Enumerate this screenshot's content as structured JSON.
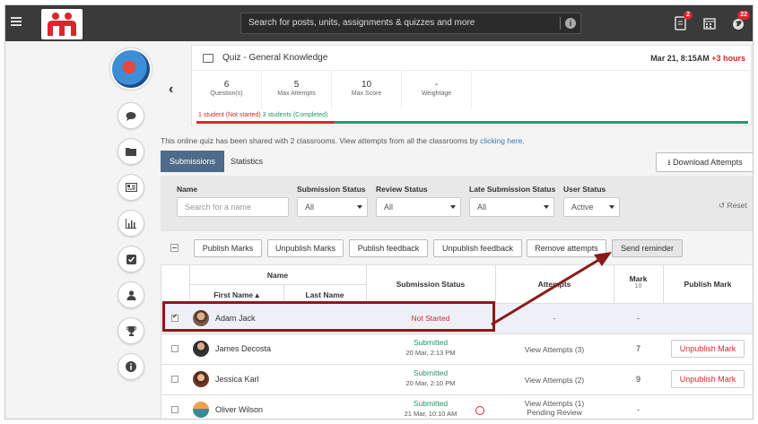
{
  "topbar": {
    "search_placeholder": "Search for posts, units, assignments & quizzes and more",
    "notifications_badge": "2",
    "globe_badge": "22"
  },
  "quiz": {
    "title": "Quiz - General Knowledge",
    "date": "Mar 21, 8:15AM",
    "late": "+3 hours",
    "stats": [
      {
        "value": "6",
        "label": "Question(s)"
      },
      {
        "value": "5",
        "label": "Max Attempts"
      },
      {
        "value": "10",
        "label": "Max Score"
      },
      {
        "value": "-",
        "label": "Weightage"
      }
    ],
    "not_started_text": "1 student (Not started)",
    "completed_text": "3 students (Completed)"
  },
  "shared": {
    "text": "This online quiz has been shared with 2 classrooms. View attempts from all the classrooms by",
    "link": "clicking here."
  },
  "tabs": {
    "submissions": "Submissions",
    "statistics": "Statistics"
  },
  "download_label": "Download Attempts",
  "filters": {
    "name_label": "Name",
    "name_placeholder": "Search for a name",
    "submission_status_label": "Submission Status",
    "submission_status_value": "All",
    "review_status_label": "Review Status",
    "review_status_value": "All",
    "late_submission_label": "Late Submission Status",
    "late_submission_value": "All",
    "user_status_label": "User Status",
    "user_status_value": "Active",
    "reset_label": "Reset"
  },
  "actions": {
    "publish_marks": "Publish Marks",
    "unpublish_marks": "Unpublish Marks",
    "publish_feedback": "Publish feedback",
    "unpublish_feedback": "Unpublish feedback",
    "remove_attempts": "Remove attempts",
    "send_reminder": "Send reminder"
  },
  "table": {
    "headers": {
      "name": "Name",
      "first_name": "First Name",
      "last_name": "Last Name",
      "submission_status": "Submission Status",
      "attempts": "Attempts",
      "mark": "Mark",
      "mark_max": "10",
      "publish_mark": "Publish Mark"
    },
    "rows": [
      {
        "name": "Adam Jack",
        "status": "Not Started",
        "date": "",
        "attempts": "-",
        "attempts2": "",
        "mark": "-",
        "publish": ""
      },
      {
        "name": "James Decosta",
        "status": "Submitted",
        "date": "20 Mar, 2:13 PM",
        "attempts": "View Attempts (3)",
        "attempts2": "",
        "mark": "7",
        "publish": "Unpublish Mark"
      },
      {
        "name": "Jessica Karl",
        "status": "Submitted",
        "date": "20 Mar, 2:10 PM",
        "attempts": "View Attempts (2)",
        "attempts2": "",
        "mark": "9",
        "publish": "Unpublish Mark"
      },
      {
        "name": "Oliver Wilson",
        "status": "Submitted",
        "date": "21 Mar, 10:10 AM",
        "attempts": "View Attempts (1)",
        "attempts2": "Pending Review",
        "mark": "-",
        "publish": ""
      }
    ]
  },
  "colors": {
    "topbar": "#3a3a3a",
    "accent_red": "#d9262c",
    "accent_green": "#1b9a66",
    "tab_active": "#4e6b8a",
    "highlight": "#8a1a1a"
  }
}
